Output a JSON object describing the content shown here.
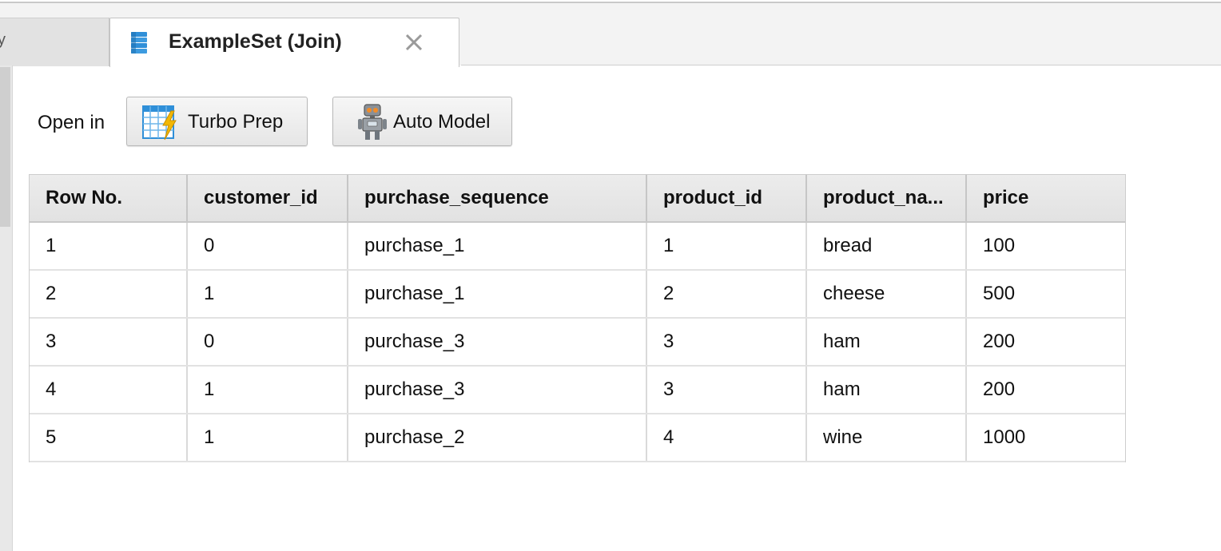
{
  "tabs": {
    "previous_tab_partial": "y",
    "active_tab": {
      "title": "ExampleSet (Join)",
      "icon": "database-stack-icon",
      "close_icon": "close-icon"
    }
  },
  "toolbar": {
    "open_in_label": "Open in",
    "turbo_prep": {
      "label": "Turbo Prep",
      "icon": "turbo-prep-grid-lightning-icon"
    },
    "auto_model": {
      "label": "Auto Model",
      "icon": "robot-icon"
    }
  },
  "table": {
    "columns": [
      "Row No.",
      "customer_id",
      "purchase_sequence",
      "product_id",
      "product_na...",
      "price"
    ],
    "rows": [
      [
        "1",
        "0",
        "purchase_1",
        "1",
        "bread",
        "100"
      ],
      [
        "2",
        "1",
        "purchase_1",
        "2",
        "cheese",
        "500"
      ],
      [
        "3",
        "0",
        "purchase_3",
        "3",
        "ham",
        "200"
      ],
      [
        "4",
        "1",
        "purchase_3",
        "3",
        "ham",
        "200"
      ],
      [
        "5",
        "1",
        "purchase_2",
        "4",
        "wine",
        "1000"
      ]
    ]
  },
  "colors": {
    "accent_blue": "#2f8fd8",
    "lightning_yellow": "#f2b705",
    "header_bg": "#e6e6e6"
  }
}
